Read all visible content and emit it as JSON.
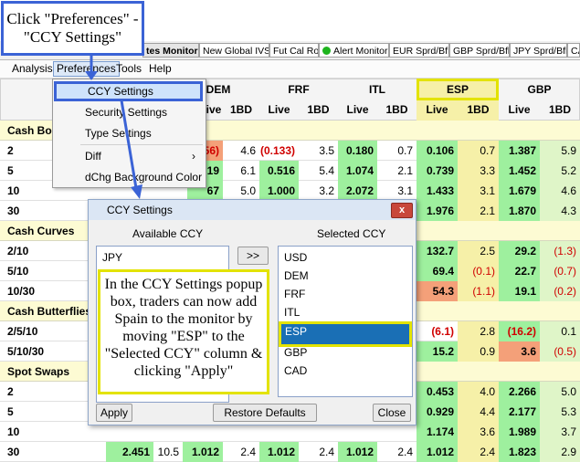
{
  "tabs": [
    {
      "label": "tes Monitor",
      "active": true
    },
    {
      "label": "New Global IVSP"
    },
    {
      "label": "Fut Cal Roll"
    },
    {
      "label": "Alert Monitor",
      "icon": "green-dot-icon"
    },
    {
      "label": "EUR Sprd/Bfly"
    },
    {
      "label": "GBP Sprd/Bfly"
    },
    {
      "label": "JPY Sprd/Bfly"
    },
    {
      "label": "CA"
    }
  ],
  "menu": {
    "items": [
      "Analysis",
      "Preferences",
      "Tools",
      "Help"
    ]
  },
  "dropdown": {
    "items": [
      "CCY Settings",
      "Security Settings",
      "Type Settings",
      "Diff",
      "dChg Background Color"
    ],
    "submenu_arrow": "›"
  },
  "grid": {
    "currencies": [
      "DEM",
      "FRF",
      "ITL",
      "ESP",
      "GBP"
    ],
    "sub_headers": [
      "Live",
      "1BD"
    ],
    "partial_sub_header": "ive",
    "rows": [
      {
        "label": "Cash Bond",
        "section": true
      },
      {
        "label": "2",
        "partial": "(56)",
        "cells": [
          "4.6",
          "(0.133)",
          "3.5",
          "0.180",
          "0.7",
          "0.106",
          "0.7",
          "1.387",
          "5.9"
        ]
      },
      {
        "label": "5",
        "partial": "19",
        "cells": [
          "6.1",
          "0.516",
          "5.4",
          "1.074",
          "2.1",
          "0.739",
          "3.3",
          "1.452",
          "5.2"
        ]
      },
      {
        "label": "10",
        "partial": "67",
        "cells": [
          "5.0",
          "1.000",
          "3.2",
          "2.072",
          "3.1",
          "1.433",
          "3.1",
          "1.679",
          "4.6"
        ]
      },
      {
        "label": "30",
        "cells": [
          "",
          "",
          "",
          "",
          "",
          "1.976",
          "2.1",
          "1.870",
          "4.3"
        ]
      },
      {
        "label": "Cash Curves",
        "section": true
      },
      {
        "label": "2/10",
        "cells": [
          "",
          "",
          "",
          "",
          "",
          "132.7",
          "2.5",
          "29.2",
          "(1.3)"
        ]
      },
      {
        "label": "5/10",
        "cells": [
          "",
          "",
          "",
          "",
          "",
          "69.4",
          "(0.1)",
          "22.7",
          "(0.7)"
        ]
      },
      {
        "label": "10/30",
        "cells": [
          "",
          "",
          "",
          "",
          "",
          "54.3",
          "(1.1)",
          "19.1",
          "(0.2)"
        ]
      },
      {
        "label": "Cash Butterflies",
        "section": true
      },
      {
        "label": "2/5/10",
        "cells": [
          "",
          "",
          "",
          "",
          "",
          "(6.1)",
          "2.8",
          "(16.2)",
          "0.1"
        ]
      },
      {
        "label": "5/10/30",
        "cells": [
          "",
          "",
          "",
          "",
          "",
          "15.2",
          "0.9",
          "3.6",
          "(0.5)"
        ]
      },
      {
        "label": "Spot Swaps",
        "section": true
      },
      {
        "label": "2",
        "cells": [
          "",
          "",
          "",
          "",
          "",
          "0.453",
          "4.0",
          "2.266",
          "5.0"
        ]
      },
      {
        "label": "5",
        "cells": [
          "",
          "",
          "",
          "",
          "",
          "0.929",
          "4.4",
          "2.177",
          "5.3"
        ]
      },
      {
        "label": "10",
        "cells": [
          "",
          "",
          "",
          "",
          "",
          "1.174",
          "3.6",
          "1.989",
          "3.7"
        ]
      },
      {
        "label": "30",
        "pre": [
          "2.451",
          "10.5"
        ],
        "cells": [
          "1.012",
          "2.4",
          "1.012",
          "2.4",
          "1.012",
          "2.4",
          "1.012",
          "2.4",
          "1.823",
          "2.9"
        ]
      }
    ]
  },
  "dialog": {
    "title": "CCY Settings",
    "available_label": "Available CCY",
    "selected_label": "Selected CCY",
    "available_items": [
      "JPY"
    ],
    "selected_items": [
      "USD",
      "DEM",
      "FRF",
      "ITL",
      "ESP",
      "GBP",
      "CAD"
    ],
    "selected_highlight": "ESP",
    "move_button": ">>",
    "apply_button": "Apply",
    "restore_button": "Restore Defaults",
    "close_button": "Close",
    "close_icon": "x"
  },
  "callouts": {
    "top": "Click \"Preferences\" - \"CCY Settings\"",
    "middle": "In the CCY Settings popup box, traders can now add Spain to the monitor by moving \"ESP\" to the \"Selected CCY\" column & clicking \"Apply\""
  },
  "colors": {
    "green_cell": "#9ef09e",
    "light_green": "#dff5c8",
    "esp_column": "#f6f0a8",
    "red_cell": "#f4a079",
    "negative_text": "#d00000",
    "accent_blue": "#3b63d6",
    "accent_yellow": "#e3e300"
  }
}
